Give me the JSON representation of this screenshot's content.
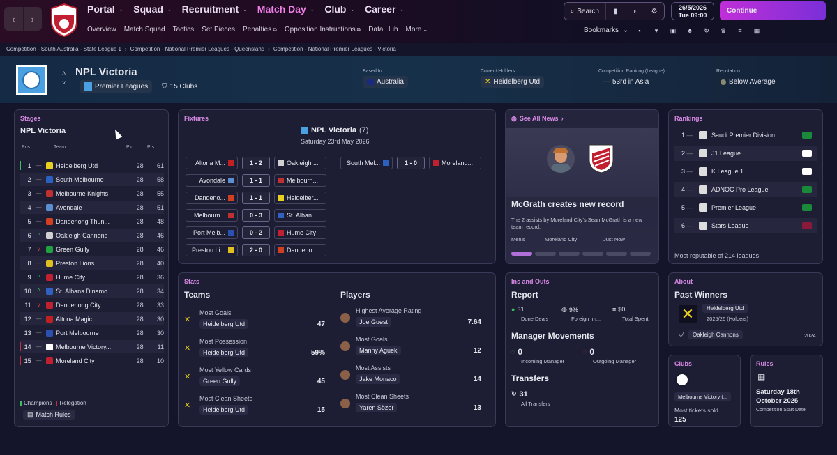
{
  "nav": {
    "main": [
      {
        "label": "Portal",
        "active": false
      },
      {
        "label": "Squad",
        "active": false
      },
      {
        "label": "Recruitment",
        "active": false
      },
      {
        "label": "Match Day",
        "active": true
      },
      {
        "label": "Club",
        "active": false
      },
      {
        "label": "Career",
        "active": false
      }
    ],
    "sub": [
      {
        "label": "Overview",
        "ext": false
      },
      {
        "label": "Match Squad",
        "ext": false
      },
      {
        "label": "Tactics",
        "ext": false
      },
      {
        "label": "Set Pieces",
        "ext": false
      },
      {
        "label": "Penalties",
        "ext": true
      },
      {
        "label": "Opposition Instructions",
        "ext": true
      },
      {
        "label": "Data Hub",
        "ext": false
      },
      {
        "label": "More",
        "ext": false
      }
    ],
    "search": "Search",
    "date": "26/5/2026",
    "time": "Tue 09:00",
    "continue": "Continue",
    "bookmarks": "Bookmarks"
  },
  "breadcrumbs": [
    "Competition - South Australia - State League 1",
    "Competition - National Premier Leagues - Queensland",
    "Competition - National Premier Leagues - Victoria"
  ],
  "header": {
    "title": "NPL Victoria",
    "league_type": "Premier Leagues",
    "clubs": "15 Clubs",
    "based_in_label": "Based In",
    "based_in": "Australia",
    "holders_label": "Current Holders",
    "holders": "Heidelberg Utd",
    "ranking_label": "Competition Ranking (League)",
    "ranking": "53rd in Asia",
    "reputation_label": "Reputation",
    "reputation": "Below Average"
  },
  "stages": {
    "title": "Stages",
    "competition": "NPL Victoria",
    "cols": [
      "Pos",
      "Team",
      "Pld",
      "Pts"
    ],
    "rows": [
      {
        "pos": "1",
        "mv": "—",
        "team": "Heidelberg Utd",
        "pld": "28",
        "pts": "61",
        "mark": "#3ac060",
        "color": "#e8d020"
      },
      {
        "pos": "2",
        "mv": "—",
        "team": "South Melbourne",
        "pld": "28",
        "pts": "58",
        "mark": "",
        "color": "#2a60c0"
      },
      {
        "pos": "3",
        "mv": "—",
        "team": "Melbourne Knights",
        "pld": "28",
        "pts": "55",
        "mark": "",
        "color": "#c03030"
      },
      {
        "pos": "4",
        "mv": "—",
        "team": "Avondale",
        "pld": "28",
        "pts": "51",
        "mark": "",
        "color": "#5a90d0"
      },
      {
        "pos": "5",
        "mv": "—",
        "team": "Dandenong Thun...",
        "pld": "28",
        "pts": "48",
        "mark": "",
        "color": "#d04020"
      },
      {
        "pos": "6",
        "mv": "^",
        "team": "Oakleigh Cannons",
        "pld": "28",
        "pts": "46",
        "mark": "",
        "color": "#d0d0d0"
      },
      {
        "pos": "7",
        "mv": "v",
        "team": "Green Gully",
        "pld": "28",
        "pts": "46",
        "mark": "",
        "color": "#20a040"
      },
      {
        "pos": "8",
        "mv": "—",
        "team": "Preston Lions",
        "pld": "28",
        "pts": "40",
        "mark": "",
        "color": "#e0c020"
      },
      {
        "pos": "9",
        "mv": "^",
        "team": "Hume City",
        "pld": "28",
        "pts": "36",
        "mark": "",
        "color": "#c02030"
      },
      {
        "pos": "10",
        "mv": "^",
        "team": "St. Albans Dinamo",
        "pld": "28",
        "pts": "34",
        "mark": "",
        "color": "#3060c0"
      },
      {
        "pos": "11",
        "mv": "v",
        "team": "Dandenong City",
        "pld": "28",
        "pts": "33",
        "mark": "",
        "color": "#c02030"
      },
      {
        "pos": "12",
        "mv": "—",
        "team": "Altona Magic",
        "pld": "28",
        "pts": "30",
        "mark": "",
        "color": "#c02020"
      },
      {
        "pos": "13",
        "mv": "—",
        "team": "Port Melbourne",
        "pld": "28",
        "pts": "30",
        "mark": "",
        "color": "#2a50b0"
      },
      {
        "pos": "14",
        "mv": "—",
        "team": "Melbourne Victory...",
        "pld": "28",
        "pts": "11",
        "mark": "#c03040",
        "color": "#ffffff"
      },
      {
        "pos": "15",
        "mv": "—",
        "team": "Moreland City",
        "pld": "28",
        "pts": "10",
        "mark": "#c03040",
        "color": "#c02030"
      }
    ],
    "legend_champions": "Champions",
    "legend_relegation": "Relegation",
    "match_rules": "Match Rules"
  },
  "fixtures": {
    "title": "Fixtures",
    "comp": "NPL Victoria",
    "round": "(7)",
    "date": "Saturday 23rd May 2026",
    "left": [
      {
        "home": "Altona M...",
        "score": "1 - 2",
        "away": "Oakleigh ..."
      },
      {
        "home": "Avondale",
        "score": "1 - 1",
        "away": "Melbourn..."
      },
      {
        "home": "Dandeno...",
        "score": "1 - 1",
        "away": "Heidelber..."
      },
      {
        "home": "Melbourn...",
        "score": "0 - 3",
        "away": "St. Alban..."
      },
      {
        "home": "Port Melb...",
        "score": "0 - 2",
        "away": "Hume City"
      },
      {
        "home": "Preston Li...",
        "score": "2 - 0",
        "away": "Dandeno..."
      }
    ],
    "right": [
      {
        "home": "South Mel...",
        "score": "1 - 0",
        "away": "Moreland..."
      }
    ]
  },
  "news": {
    "link": "See All News",
    "headline": "McGrath creates new record",
    "body": "The 2 assists by Moreland City's Sean McGrath is a new team record.",
    "tags": [
      "Men's",
      "Moreland City",
      "Just Now"
    ]
  },
  "rankings": {
    "title": "Rankings",
    "rows": [
      {
        "pos": "1",
        "league": "Saudi Premier Division",
        "flag": "#1a8a3a"
      },
      {
        "pos": "2",
        "league": "J1 League",
        "flag": "#ffffff"
      },
      {
        "pos": "3",
        "league": "K League 1",
        "flag": "#ffffff"
      },
      {
        "pos": "4",
        "league": "ADNOC Pro League",
        "flag": "#1a8a3a"
      },
      {
        "pos": "5",
        "league": "Premier League",
        "flag": "#1a8a3a"
      },
      {
        "pos": "6",
        "league": "Stars League",
        "flag": "#8a1a3a"
      }
    ],
    "footer": "Most reputable of 214 leagues"
  },
  "stats": {
    "title": "Stats",
    "teams_title": "Teams",
    "players_title": "Players",
    "teams": [
      {
        "label": "Most Goals",
        "team": "Heidelberg Utd",
        "value": "47"
      },
      {
        "label": "Most Possession",
        "team": "Heidelberg Utd",
        "value": "59%"
      },
      {
        "label": "Most Yellow Cards",
        "team": "Green Gully",
        "value": "45"
      },
      {
        "label": "Most Clean Sheets",
        "team": "Heidelberg Utd",
        "value": "15"
      }
    ],
    "players": [
      {
        "label": "Highest Average Rating",
        "player": "Joe Guest",
        "value": "7.64"
      },
      {
        "label": "Most Goals",
        "player": "Manny Aguek",
        "value": "12"
      },
      {
        "label": "Most Assists",
        "player": "Jake Monaco",
        "value": "14"
      },
      {
        "label": "Most Clean Sheets",
        "player": "Yaren Sözer",
        "value": "13"
      }
    ]
  },
  "insouts": {
    "title": "Ins and Outs",
    "report": "Report",
    "deals": "31",
    "deals_label": "Done Deals",
    "foreign": "9%",
    "foreign_label": "Foreign Im...",
    "spent": "$0",
    "spent_label": "Total Spent",
    "mgr_title": "Manager Movements",
    "incoming": "0",
    "incoming_label": "Incoming Manager",
    "outgoing": "0",
    "outgoing_label": "Outgoing Manager",
    "transfers_title": "Transfers",
    "transfers": "31",
    "transfers_label": "All Transfers"
  },
  "about": {
    "title": "About",
    "past_winners": "Past Winners",
    "winner": "Heidelberg Utd",
    "winner_season": "2025/26 (Holders)",
    "prev": "Oakleigh Cannons",
    "prev_year": "2024"
  },
  "clubs": {
    "title": "Clubs",
    "club": "Melbourne Victory (...",
    "tickets_label": "Most tickets sold",
    "tickets": "125"
  },
  "rules": {
    "title": "Rules",
    "date_line1": "Saturday 18th",
    "date_line2": "October 2025",
    "date_label": "Competition Start Date"
  }
}
